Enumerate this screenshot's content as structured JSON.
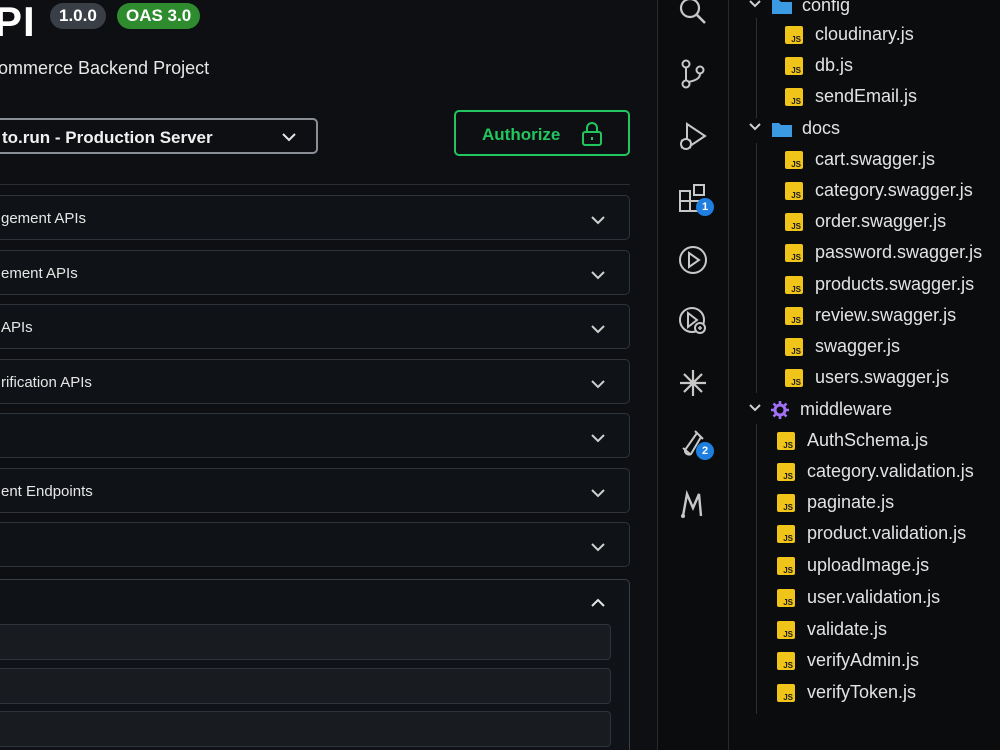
{
  "swagger": {
    "title": "PI",
    "version_badge": "1.0.0",
    "oas_badge": "OAS 3.0",
    "description": "ommerce Backend Project",
    "server_selected": "to.run - Production Server",
    "authorize_label": "Authorize",
    "tags": [
      {
        "label": "gement APIs"
      },
      {
        "label": "ement APIs"
      },
      {
        "label": "APIs"
      },
      {
        "label": "rification APIs"
      },
      {
        "label": ""
      },
      {
        "label": "ent Endpoints"
      },
      {
        "label": ""
      }
    ],
    "colors": {
      "accent_green": "#22c55e",
      "oas_green": "#2e8b2e",
      "badge_grey": "#3a3f47"
    }
  },
  "activity_bar": {
    "items": [
      {
        "icon": "search-icon"
      },
      {
        "icon": "source-control-icon"
      },
      {
        "icon": "run-debug-icon"
      },
      {
        "icon": "extensions-icon",
        "badge": "1"
      },
      {
        "icon": "deploy-icon"
      },
      {
        "icon": "test-runner-icon"
      },
      {
        "icon": "sparkle-icon"
      },
      {
        "icon": "testing-flask-icon",
        "badge": "2"
      },
      {
        "icon": "custom-m-icon"
      }
    ]
  },
  "explorer": {
    "folders": {
      "config": "config",
      "docs": "docs",
      "middleware": "middleware"
    },
    "config_files": [
      "cloudinary.js",
      "db.js",
      "sendEmail.js"
    ],
    "docs_files": [
      "cart.swagger.js",
      "category.swagger.js",
      "order.swagger.js",
      "password.swagger.js",
      "products.swagger.js",
      "review.swagger.js",
      "swagger.js",
      "users.swagger.js"
    ],
    "middleware_files": [
      "AuthSchema.js",
      "category.validation.js",
      "paginate.js",
      "product.validation.js",
      "uploadImage.js",
      "user.validation.js",
      "validate.js",
      "verifyAdmin.js",
      "verifyToken.js"
    ],
    "colors": {
      "js_icon": "#f0c419",
      "folder": "#3b9ae1",
      "middleware_gear": "#a371f7"
    }
  }
}
